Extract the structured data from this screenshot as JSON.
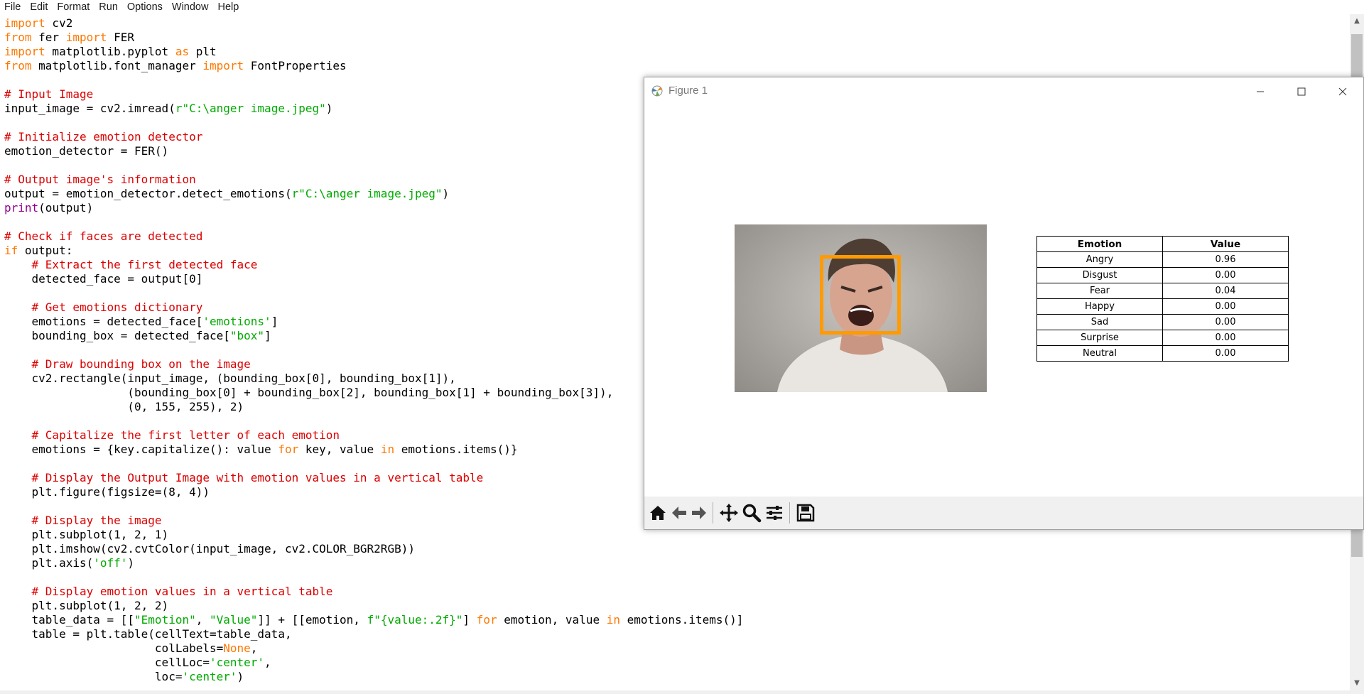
{
  "menubar": {
    "items": [
      "File",
      "Edit",
      "Format",
      "Run",
      "Options",
      "Window",
      "Help"
    ]
  },
  "code": {
    "lines": [
      [
        [
          "kw",
          "import"
        ],
        [
          "t",
          " cv2"
        ]
      ],
      [
        [
          "kw",
          "from"
        ],
        [
          "t",
          " fer "
        ],
        [
          "kw",
          "import"
        ],
        [
          "t",
          " FER"
        ]
      ],
      [
        [
          "kw",
          "import"
        ],
        [
          "t",
          " matplotlib.pyplot "
        ],
        [
          "kw",
          "as"
        ],
        [
          "t",
          " plt"
        ]
      ],
      [
        [
          "kw",
          "from"
        ],
        [
          "t",
          " matplotlib.font_manager "
        ],
        [
          "kw",
          "import"
        ],
        [
          "t",
          " FontProperties"
        ]
      ],
      [],
      [
        [
          "cm",
          "# Input Image"
        ]
      ],
      [
        [
          "t",
          "input_image = cv2.imread("
        ],
        [
          "str",
          "r\"C:\\anger image.jpeg\""
        ],
        [
          "t",
          ")"
        ]
      ],
      [],
      [
        [
          "cm",
          "# Initialize emotion detector"
        ]
      ],
      [
        [
          "t",
          "emotion_detector = FER()"
        ]
      ],
      [],
      [
        [
          "cm",
          "# Output image's information"
        ]
      ],
      [
        [
          "t",
          "output = emotion_detector.detect_emotions("
        ],
        [
          "str",
          "r\"C:\\anger image.jpeg\""
        ],
        [
          "t",
          ")"
        ]
      ],
      [
        [
          "bi",
          "print"
        ],
        [
          "t",
          "(output)"
        ]
      ],
      [],
      [
        [
          "cm",
          "# Check if faces are detected"
        ]
      ],
      [
        [
          "kw",
          "if"
        ],
        [
          "t",
          " output:"
        ]
      ],
      [
        [
          "t",
          "    "
        ],
        [
          "cm",
          "# Extract the first detected face"
        ]
      ],
      [
        [
          "t",
          "    detected_face = output[0]"
        ]
      ],
      [],
      [
        [
          "t",
          "    "
        ],
        [
          "cm",
          "# Get emotions dictionary"
        ]
      ],
      [
        [
          "t",
          "    emotions = detected_face["
        ],
        [
          "str",
          "'emotions'"
        ],
        [
          "t",
          "]"
        ]
      ],
      [
        [
          "t",
          "    bounding_box = detected_face["
        ],
        [
          "str",
          "\"box\""
        ],
        [
          "t",
          "]"
        ]
      ],
      [],
      [
        [
          "t",
          "    "
        ],
        [
          "cm",
          "# Draw bounding box on the image"
        ]
      ],
      [
        [
          "t",
          "    cv2.rectangle(input_image, (bounding_box[0], bounding_box[1]),"
        ]
      ],
      [
        [
          "t",
          "                  (bounding_box[0] + bounding_box[2], bounding_box[1] + bounding_box[3]),"
        ]
      ],
      [
        [
          "t",
          "                  (0, 155, 255), 2)"
        ]
      ],
      [],
      [
        [
          "t",
          "    "
        ],
        [
          "cm",
          "# Capitalize the first letter of each emotion"
        ]
      ],
      [
        [
          "t",
          "    emotions = {key.capitalize(): value "
        ],
        [
          "kw",
          "for"
        ],
        [
          "t",
          " key, value "
        ],
        [
          "kw",
          "in"
        ],
        [
          "t",
          " emotions.items()}"
        ]
      ],
      [],
      [
        [
          "t",
          "    "
        ],
        [
          "cm",
          "# Display the Output Image with emotion values in a vertical table"
        ]
      ],
      [
        [
          "t",
          "    plt.figure(figsize=(8, 4))"
        ]
      ],
      [],
      [
        [
          "t",
          "    "
        ],
        [
          "cm",
          "# Display the image"
        ]
      ],
      [
        [
          "t",
          "    plt.subplot(1, 2, 1)"
        ]
      ],
      [
        [
          "t",
          "    plt.imshow(cv2.cvtColor(input_image, cv2.COLOR_BGR2RGB))"
        ]
      ],
      [
        [
          "t",
          "    plt.axis("
        ],
        [
          "str",
          "'off'"
        ],
        [
          "t",
          ")"
        ]
      ],
      [],
      [
        [
          "t",
          "    "
        ],
        [
          "cm",
          "# Display emotion values in a vertical table"
        ]
      ],
      [
        [
          "t",
          "    plt.subplot(1, 2, 2)"
        ]
      ],
      [
        [
          "t",
          "    table_data = [["
        ],
        [
          "str",
          "\"Emotion\""
        ],
        [
          "t",
          ", "
        ],
        [
          "str",
          "\"Value\""
        ],
        [
          "t",
          "]] + [[emotion, "
        ],
        [
          "str",
          "f\"{value:.2f}\""
        ],
        [
          "t",
          "] "
        ],
        [
          "kw",
          "for"
        ],
        [
          "t",
          " emotion, value "
        ],
        [
          "kw",
          "in"
        ],
        [
          "t",
          " emotions.items()]"
        ]
      ],
      [
        [
          "t",
          "    table = plt.table(cellText=table_data,"
        ]
      ],
      [
        [
          "t",
          "                      colLabels="
        ],
        [
          "kw",
          "None"
        ],
        [
          "t",
          ","
        ]
      ],
      [
        [
          "t",
          "                      cellLoc="
        ],
        [
          "str",
          "'center'"
        ],
        [
          "t",
          ","
        ]
      ],
      [
        [
          "t",
          "                      loc="
        ],
        [
          "str",
          "'center'"
        ],
        [
          "t",
          ")"
        ]
      ]
    ]
  },
  "figure": {
    "title": "Figure 1",
    "table": {
      "headers": [
        "Emotion",
        "Value"
      ],
      "rows": [
        [
          "Angry",
          "0.96"
        ],
        [
          "Disgust",
          "0.00"
        ],
        [
          "Fear",
          "0.04"
        ],
        [
          "Happy",
          "0.00"
        ],
        [
          "Sad",
          "0.00"
        ],
        [
          "Surprise",
          "0.00"
        ],
        [
          "Neutral",
          "0.00"
        ]
      ]
    },
    "toolbar": [
      "home-icon",
      "back-icon",
      "forward-icon",
      "pan-icon",
      "zoom-icon",
      "configure-subplots-icon",
      "save-icon"
    ]
  },
  "colors": {
    "keyword": "#ff7700",
    "builtin": "#900090",
    "string": "#00aa00",
    "comment": "#dd0000",
    "bounding_box": "#ff9b00"
  }
}
